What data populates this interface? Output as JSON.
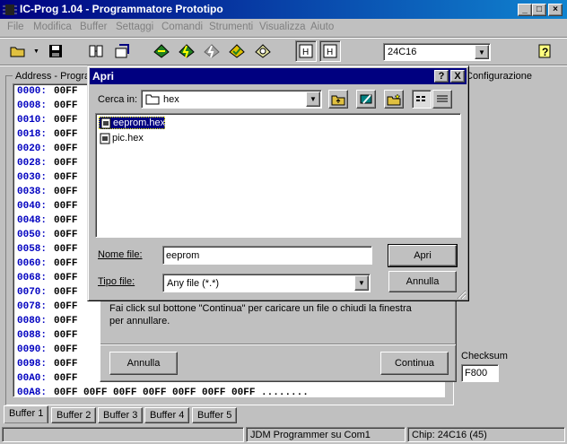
{
  "window": {
    "title": "IC-Prog 1.04 - Programmatore Prototipo"
  },
  "menu": [
    "File",
    "Modifica",
    "Buffer",
    "Settaggi",
    "Comandi",
    "Strumenti",
    "Visualizza",
    "Aiuto"
  ],
  "toolbar": {
    "chip_select": "24C16"
  },
  "left_panel": {
    "title": "Address - Program"
  },
  "hex_rows": [
    "0000:",
    "0008:",
    "0010:",
    "0018:",
    "0020:",
    "0028:",
    "0030:",
    "0038:",
    "0040:",
    "0048:",
    "0050:",
    "0058:",
    "0060:",
    "0068:",
    "0070:",
    "0078:",
    "0080:",
    "0088:",
    "0090:",
    "0098:",
    "00A0:",
    "00A8:"
  ],
  "hex_first_col": "00FF",
  "hex_partial": "00FF",
  "hex_last_row": "00FF 00FF 00FF 00FF 00FF 00FF 00FF ........",
  "right_panel": {
    "config_label": "Configurazione",
    "checksum_label": "Checksum",
    "checksum_value": "F800"
  },
  "dialog": {
    "title": "Apri",
    "help": "?",
    "close": "X",
    "look_in_label": "Cerca in:",
    "look_in_value": "hex",
    "files": [
      "eeprom.hex",
      "pic.hex"
    ],
    "filename_label": "Nome file:",
    "filename_value": "eeprom",
    "filetype_label": "Tipo file:",
    "filetype_value": "Any file (*.*)",
    "open_button": "Apri",
    "cancel_button": "Annulla"
  },
  "info_panel": {
    "message": "Fai click sul bottone \"Continua\" per caricare un file o chiudi la finestra per annullare.",
    "cancel_button": "Annulla",
    "continue_button": "Continua"
  },
  "tabs": [
    "Buffer 1",
    "Buffer 2",
    "Buffer 3",
    "Buffer 4",
    "Buffer 5"
  ],
  "status": {
    "programmer": "JDM Programmer su Com1",
    "chip": "Chip: 24C16  (45)"
  }
}
